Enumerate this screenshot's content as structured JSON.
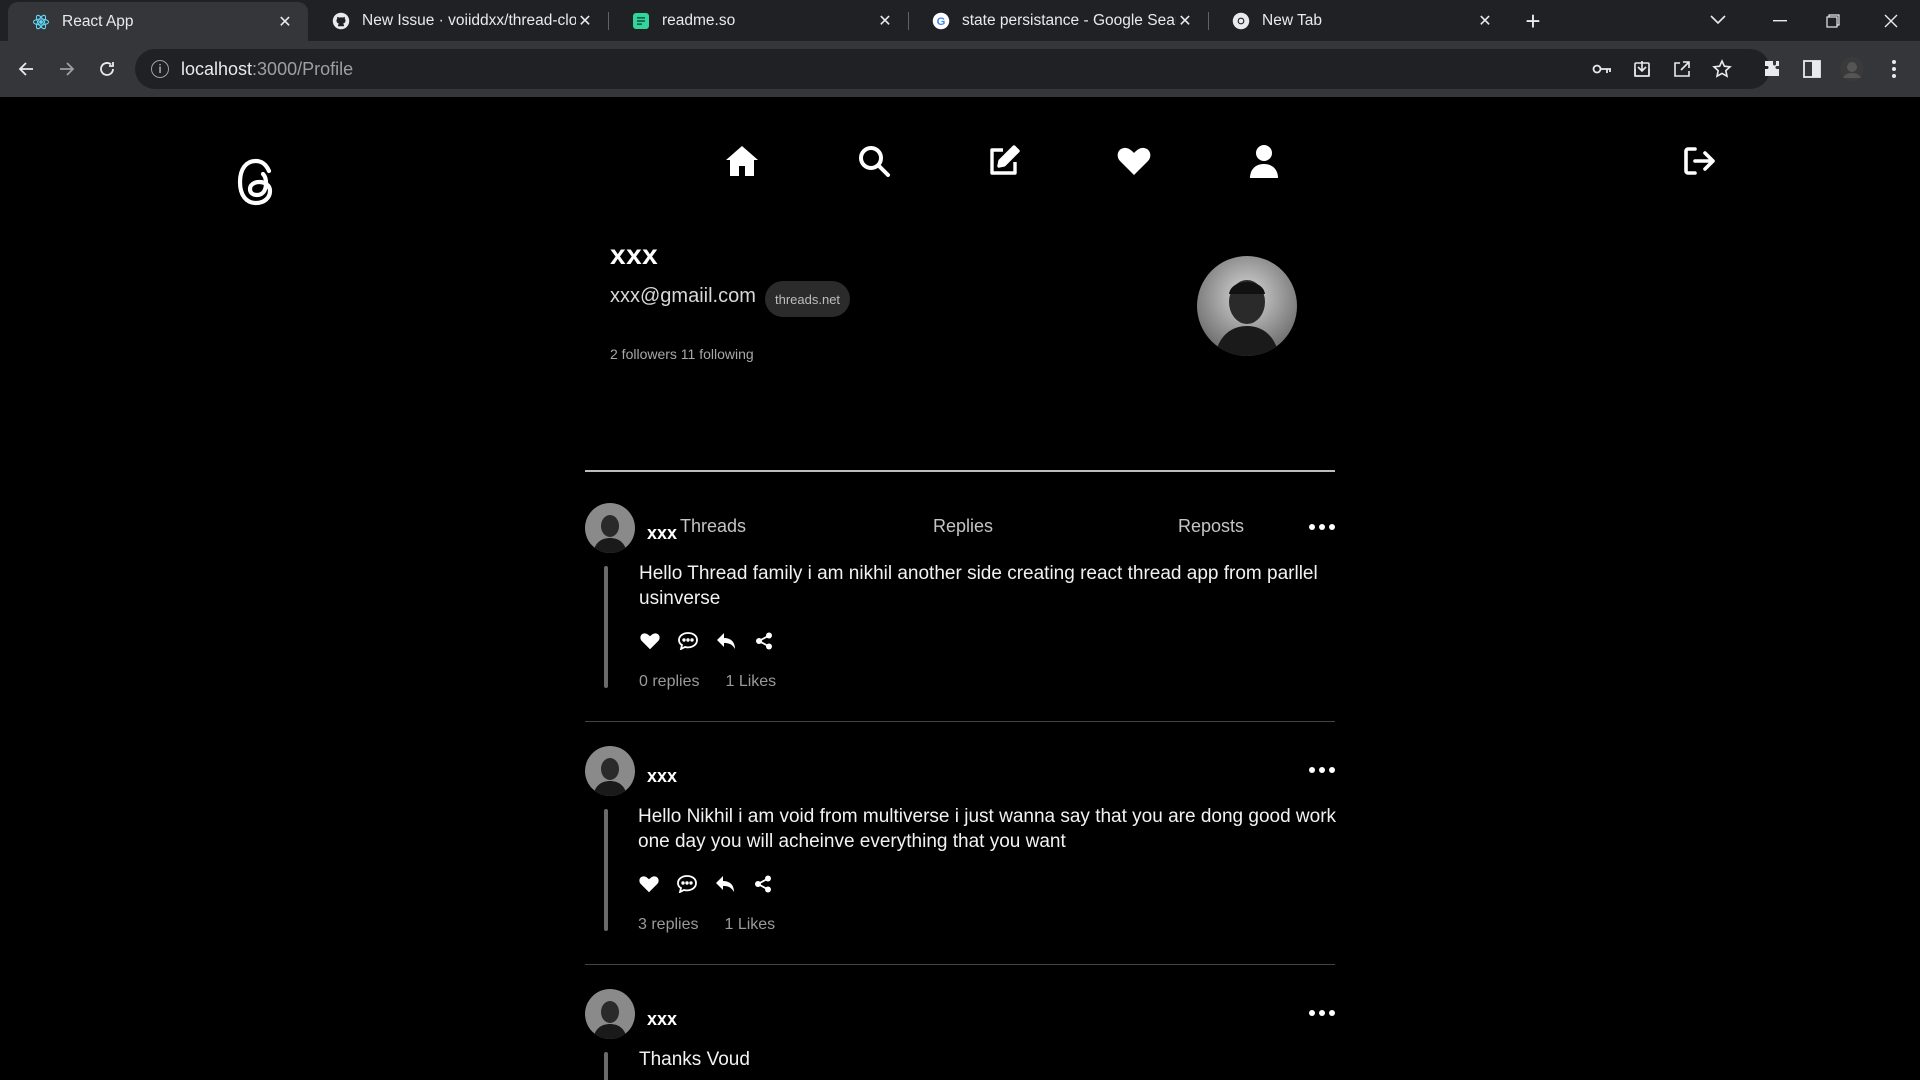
{
  "browser": {
    "tabs": [
      {
        "title": "React App",
        "favicon": "react-icon",
        "active": true
      },
      {
        "title": "New Issue · voiiddxx/thread-clone",
        "favicon": "github-icon",
        "active": false
      },
      {
        "title": "readme.so",
        "favicon": "readme-icon",
        "active": false
      },
      {
        "title": "state persistance - Google Search",
        "favicon": "google-icon",
        "active": false
      },
      {
        "title": "New Tab",
        "favicon": "chrome-icon",
        "active": false
      }
    ],
    "url_host": "localhost",
    "url_path": ":3000/Profile"
  },
  "app": {
    "logo": "threads-logo",
    "nav": [
      "home-icon",
      "search-icon",
      "compose-icon",
      "heart-icon",
      "profile-icon"
    ],
    "logout": "logout-icon"
  },
  "profile": {
    "name": "xxx",
    "email": "xxx@gmaiil.com",
    "badge": "threads.net",
    "stats": "2 followers 11 following"
  },
  "tabs": [
    "Threads",
    "Replies",
    "Reposts"
  ],
  "posts": [
    {
      "author": "xxx",
      "text": "Hello Thread family i am nikhil another side creating react thread app from parllel usinverse",
      "replies": "0 replies",
      "likes": "1 Likes"
    },
    {
      "author": "xxx",
      "text": "Hello Nikhil i am void from multiverse i just wanna say that you are dong good work one day you will acheinve everything that you want",
      "replies": "3 replies",
      "likes": "1 Likes"
    },
    {
      "author": "xxx",
      "text": "Thanks Voud"
    }
  ],
  "colors": {
    "background": "#000000",
    "chrome_tabbar": "#202124",
    "chrome_toolbar": "#35363a"
  }
}
